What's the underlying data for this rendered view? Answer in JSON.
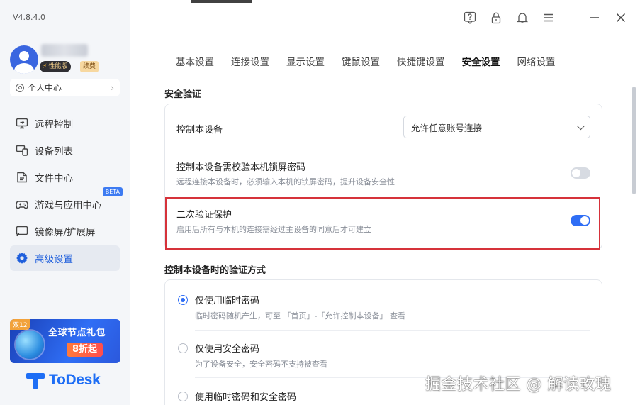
{
  "app": {
    "version": "V4.8.4.0",
    "window_title_partial": ""
  },
  "user": {
    "perf_badge": "性能版",
    "renew_badge": "续费",
    "personal_center": "个人中心"
  },
  "nav": {
    "items": [
      {
        "label": "远程控制",
        "icon": "monitor-icon",
        "active": false
      },
      {
        "label": "设备列表",
        "icon": "devices-icon",
        "active": false
      },
      {
        "label": "文件中心",
        "icon": "file-icon",
        "active": false
      },
      {
        "label": "游戏与应用中心",
        "icon": "gamepad-icon",
        "active": false,
        "badge": "BETA"
      },
      {
        "label": "镜像屏/扩展屏",
        "icon": "screen-cast-icon",
        "active": false
      },
      {
        "label": "高级设置",
        "icon": "gear-icon",
        "active": true
      }
    ]
  },
  "promo": {
    "tag": "双12",
    "title": "全球节点礼包",
    "discount": "8折起"
  },
  "brand": {
    "name": "ToDesk",
    "color": "#1e6ef5"
  },
  "tabs": [
    {
      "label": "基本设置",
      "active": false
    },
    {
      "label": "连接设置",
      "active": false
    },
    {
      "label": "显示设置",
      "active": false
    },
    {
      "label": "键鼠设置",
      "active": false
    },
    {
      "label": "快捷键设置",
      "active": false
    },
    {
      "label": "安全设置",
      "active": true
    },
    {
      "label": "网络设置",
      "active": false
    }
  ],
  "security": {
    "section_title": "安全验证",
    "control_device": {
      "label": "控制本设备",
      "select_value": "允许任意账号连接"
    },
    "lock_password": {
      "label": "控制本设备需校验本机锁屏密码",
      "desc": "远程连接本设备时，必须输入本机的锁屏密码，提升设备安全性",
      "enabled": false
    },
    "two_factor": {
      "label": "二次验证保护",
      "desc": "启用后所有与本机的连接需经过主设备的同意后才可建立",
      "enabled": true
    }
  },
  "verify": {
    "section_title": "控制本设备时的验证方式",
    "options": [
      {
        "label": "仅使用临时密码",
        "desc": "临时密码随机产生，可至 「首页」-「允许控制本设备」 查看",
        "checked": true
      },
      {
        "label": "仅使用安全密码",
        "desc": "为了设备安全，安全密码不支持被查看",
        "checked": false
      },
      {
        "label": "使用临时密码和安全密码",
        "desc": "",
        "checked": false
      }
    ]
  },
  "watermark": "掘金技术社区 @ 解读玫瑰",
  "colors": {
    "accent": "#2f6ef5",
    "highlight": "#d6323a",
    "active_nav_text": "#1f5fdc"
  }
}
